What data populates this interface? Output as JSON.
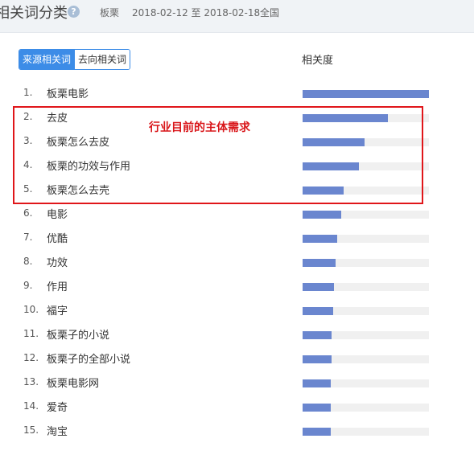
{
  "header": {
    "title": "相关词分类",
    "keyword": "板栗",
    "date_range": "2018-02-12 至 2018-02-18",
    "region": "全国"
  },
  "tabs": [
    {
      "label": "来源相关词",
      "active": true
    },
    {
      "label": "去向相关词",
      "active": false
    }
  ],
  "column_header": "相关度",
  "annotation": "行业目前的主体需求",
  "colors": {
    "accent": "#3c8ce7",
    "bar": "#6a86cf",
    "bar_track": "#f0f0f0",
    "highlight": "#e0161a"
  },
  "rows": [
    {
      "rank": "1.",
      "word": "板栗电影",
      "relevance": 1.0
    },
    {
      "rank": "2.",
      "word": "去皮",
      "relevance": 0.675
    },
    {
      "rank": "3.",
      "word": "板栗怎么去皮",
      "relevance": 0.49
    },
    {
      "rank": "4.",
      "word": "板栗的功效与作用",
      "relevance": 0.445
    },
    {
      "rank": "5.",
      "word": "板栗怎么去壳",
      "relevance": 0.325
    },
    {
      "rank": "6.",
      "word": "电影",
      "relevance": 0.305
    },
    {
      "rank": "7.",
      "word": "优酷",
      "relevance": 0.275
    },
    {
      "rank": "8.",
      "word": "功效",
      "relevance": 0.26
    },
    {
      "rank": "9.",
      "word": "作用",
      "relevance": 0.25
    },
    {
      "rank": "10.",
      "word": "福字",
      "relevance": 0.24
    },
    {
      "rank": "11.",
      "word": "板栗子的小说",
      "relevance": 0.23
    },
    {
      "rank": "12.",
      "word": "板栗子的全部小说",
      "relevance": 0.23
    },
    {
      "rank": "13.",
      "word": "板栗电影网",
      "relevance": 0.225
    },
    {
      "rank": "14.",
      "word": "爱奇",
      "relevance": 0.225
    },
    {
      "rank": "15.",
      "word": "淘宝",
      "relevance": 0.225
    }
  ]
}
